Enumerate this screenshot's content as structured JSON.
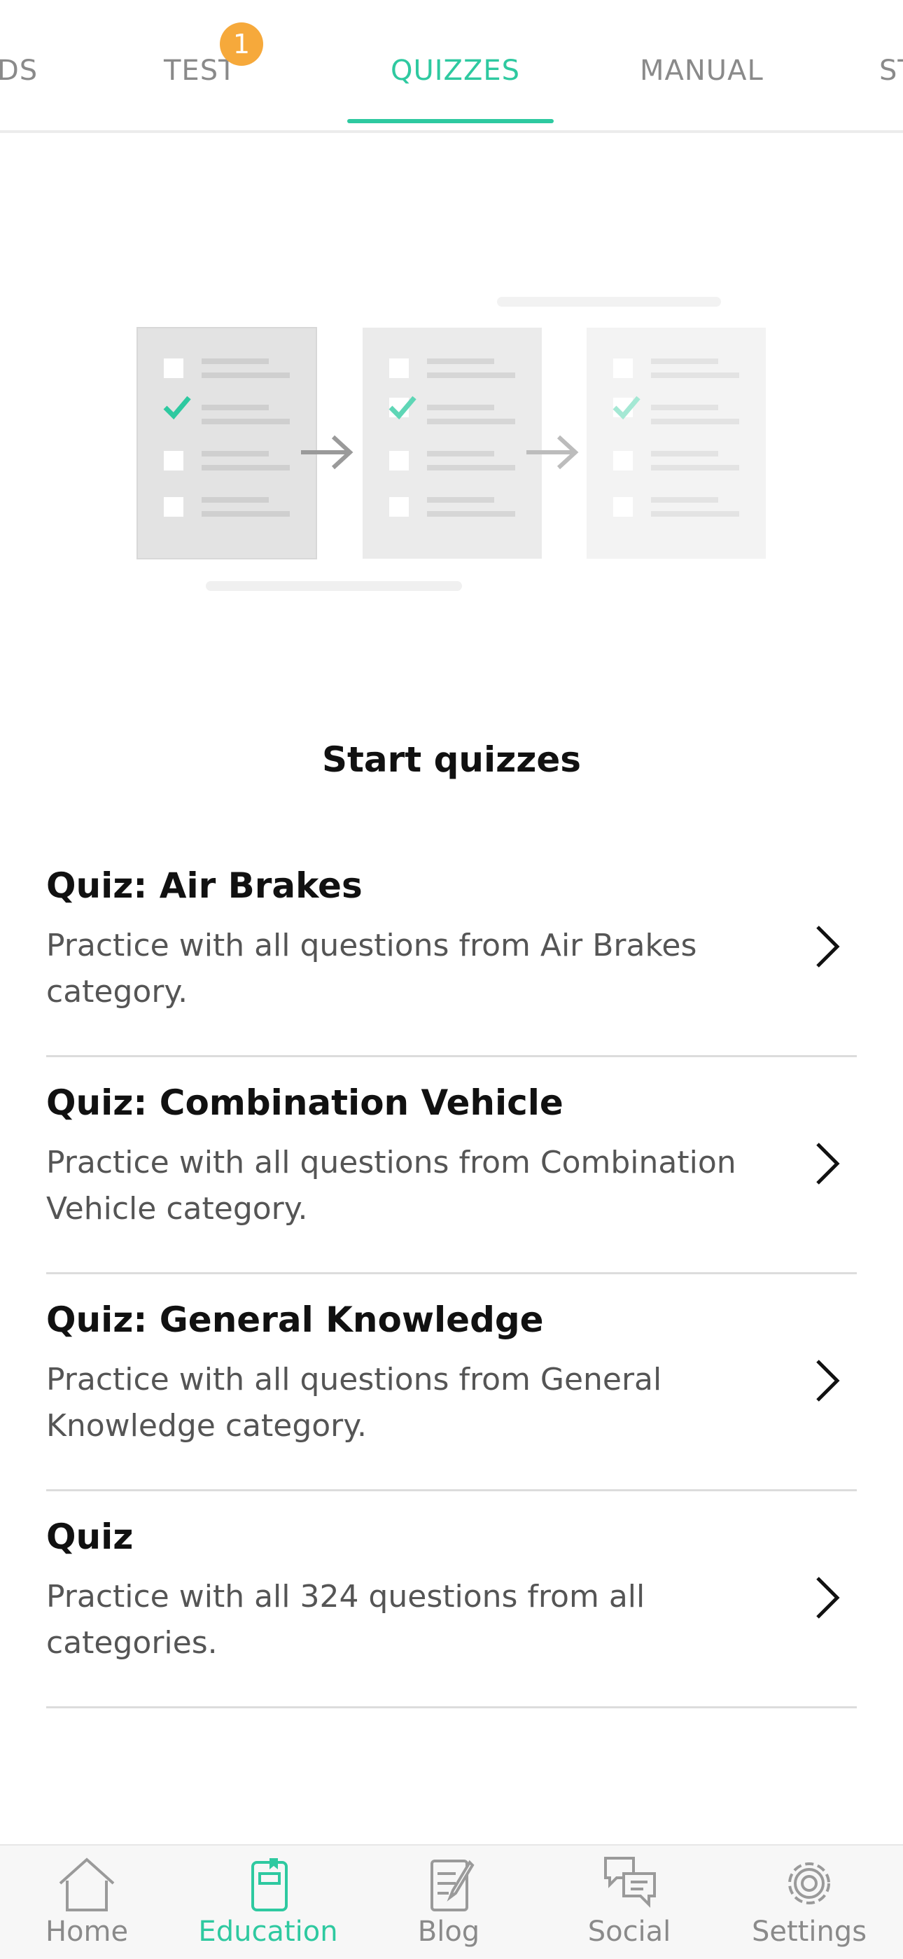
{
  "tabs": [
    {
      "label": "DS",
      "active": false
    },
    {
      "label": "TEST",
      "active": false,
      "badge": "1"
    },
    {
      "label": "QUIZZES",
      "active": true
    },
    {
      "label": "MANUAL",
      "active": false
    },
    {
      "label": "ST",
      "active": false
    }
  ],
  "heading": "Start quizzes",
  "quizzes": [
    {
      "title": "Quiz: Air Brakes",
      "description": "Practice with all questions from Air Brakes category."
    },
    {
      "title": "Quiz: Combination Vehicle",
      "description": "Practice with all questions from Combination Vehicle category."
    },
    {
      "title": "Quiz: General Knowledge",
      "description": "Practice with all questions from General Knowledge category."
    },
    {
      "title": "Quiz",
      "description": "Practice with all 324 questions from all categories."
    }
  ],
  "bottom_nav": [
    {
      "label": "Home",
      "icon": "home-icon",
      "active": false
    },
    {
      "label": "Education",
      "icon": "education-icon",
      "active": true
    },
    {
      "label": "Blog",
      "icon": "blog-icon",
      "active": false
    },
    {
      "label": "Social",
      "icon": "social-icon",
      "active": false
    },
    {
      "label": "Settings",
      "icon": "settings-icon",
      "active": false
    }
  ],
  "colors": {
    "accent": "#2ec9a0",
    "badge": "#f6a93b",
    "inactive": "#8a8a8a"
  }
}
